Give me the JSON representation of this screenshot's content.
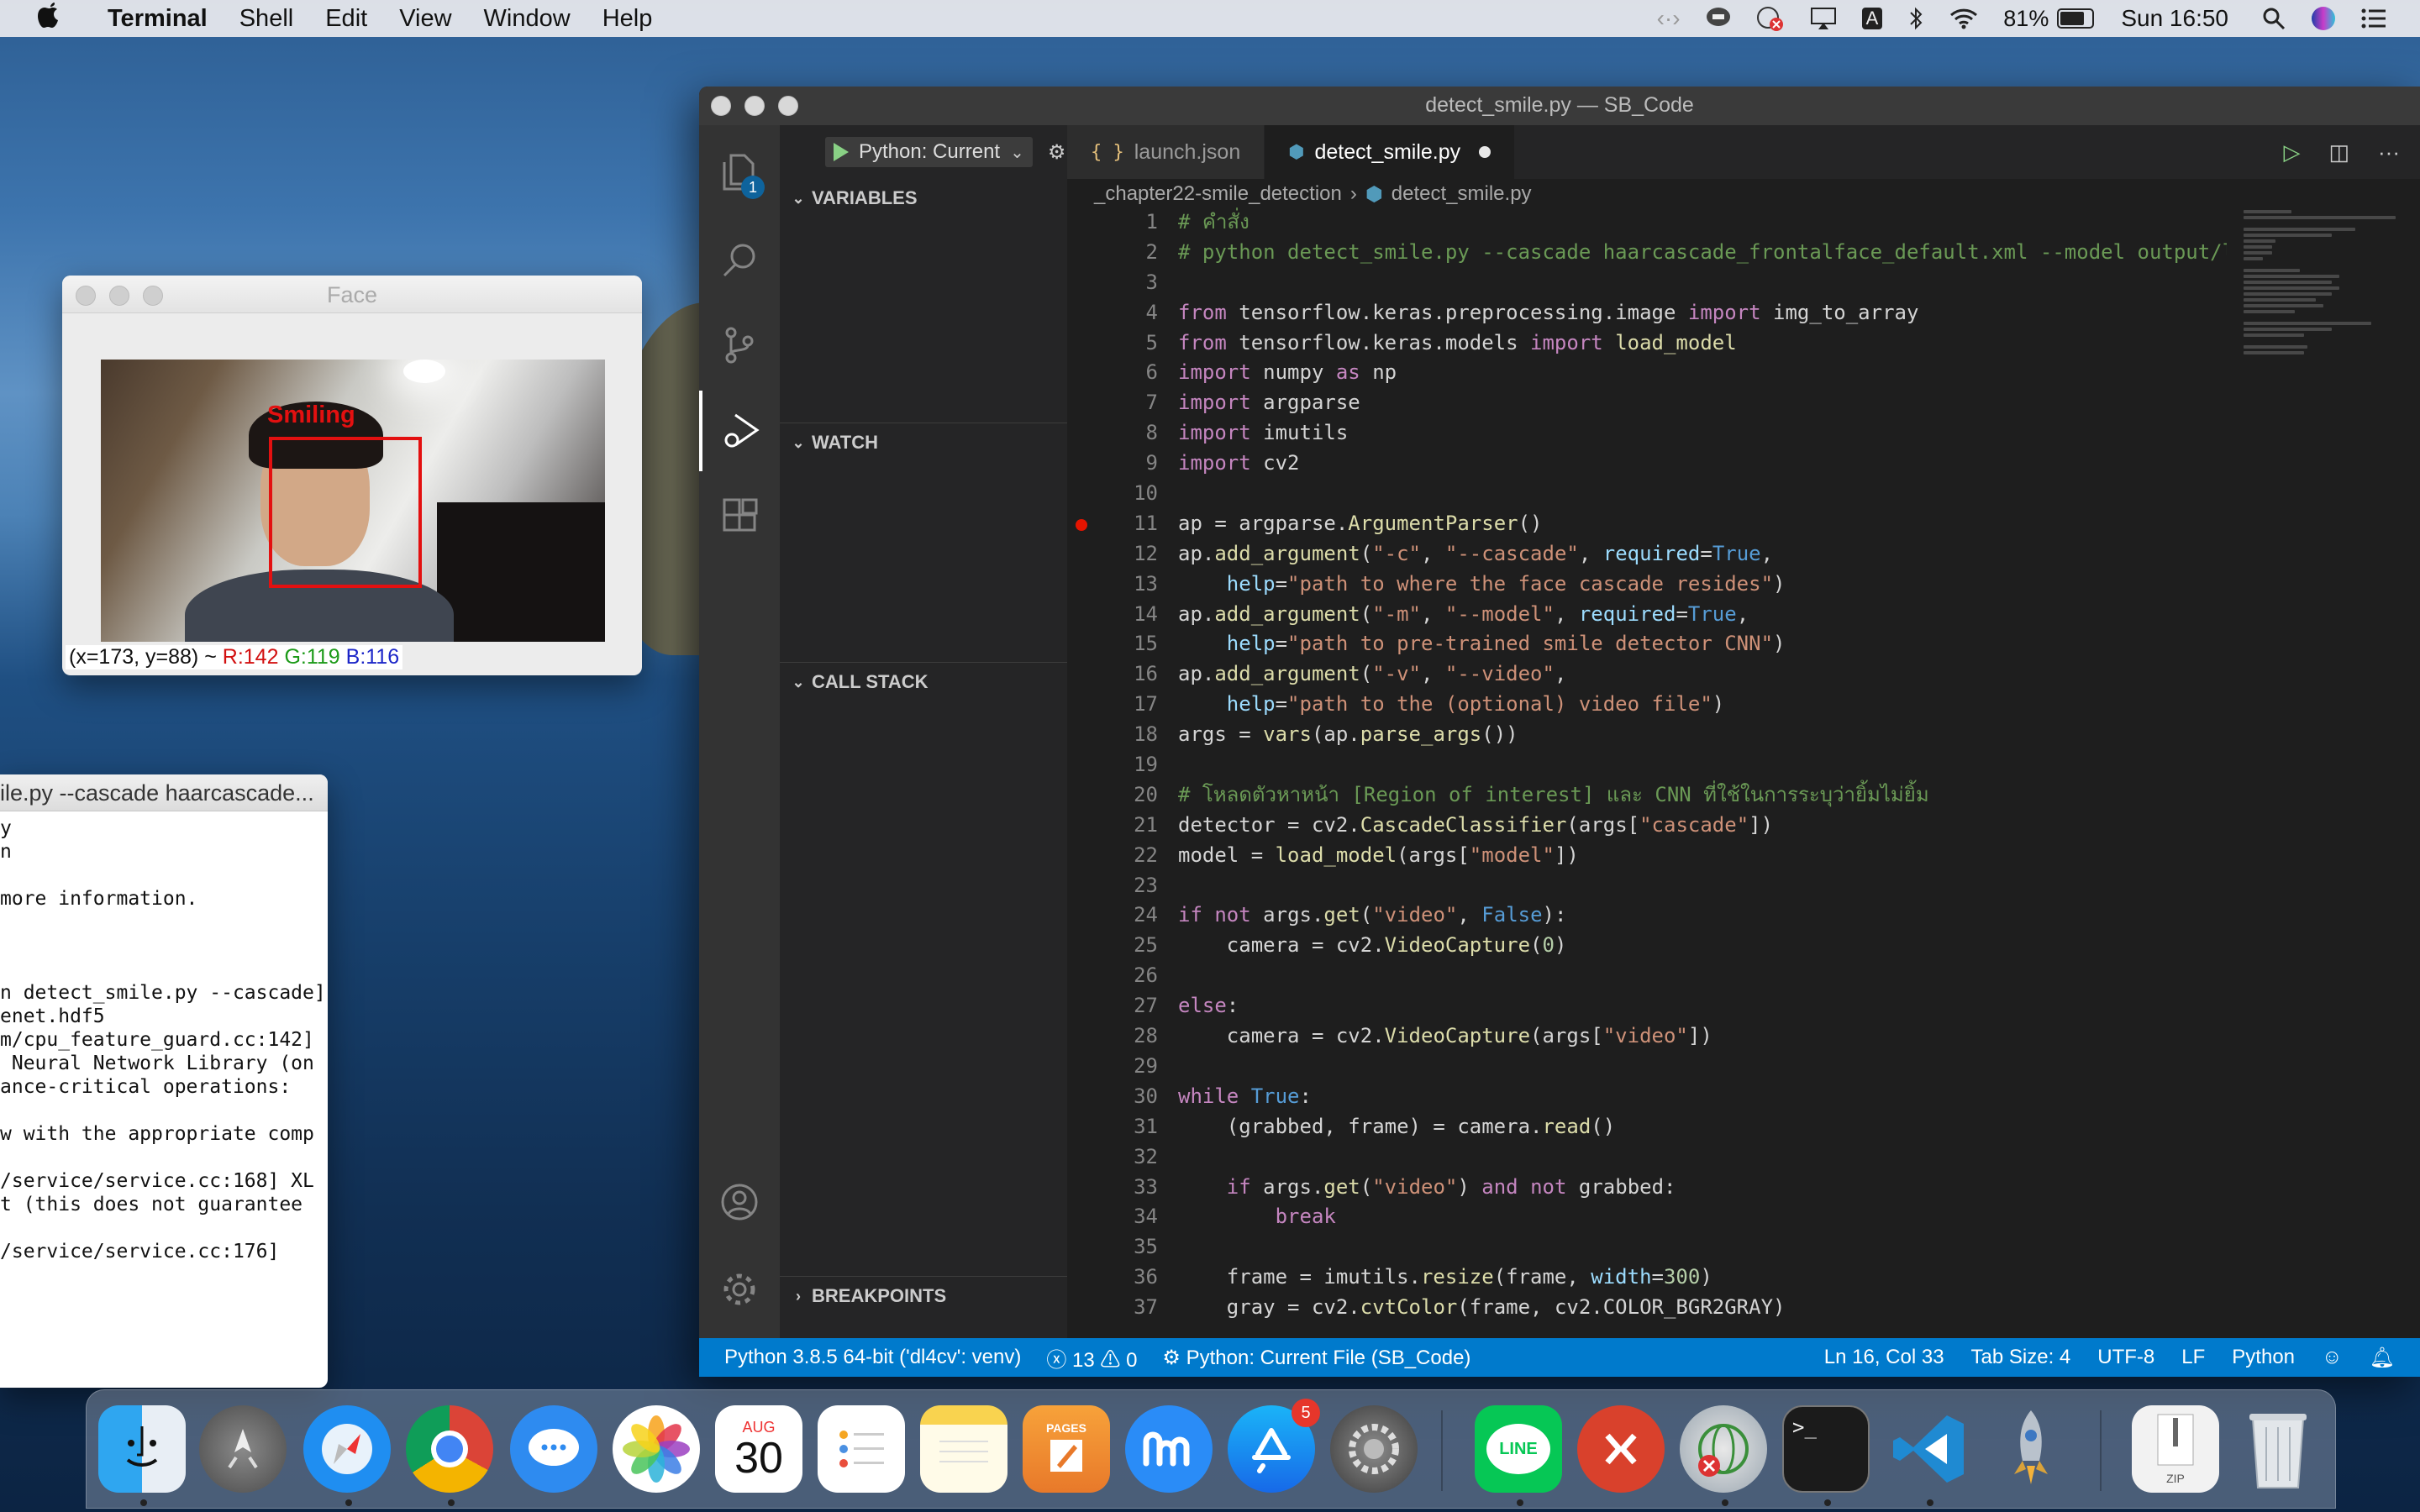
{
  "menubar": {
    "app_name": "Terminal",
    "items": [
      "Shell",
      "Edit",
      "View",
      "Window",
      "Help"
    ],
    "battery": "81%",
    "clock": "Sun 16:50"
  },
  "face_window": {
    "title": "Face",
    "label": "Smiling",
    "pixel_info": {
      "coords": "(x=173, y=88) ~",
      "r": "R:142",
      "g": "G:119",
      "b": "B:116"
    }
  },
  "terminal_window": {
    "title": "ile.py --cascade haarcascade...",
    "lines": [
      "y",
      "n                           ]",
      "",
      "more information.",
      "                            ]",
      "                            ]",
      "                            ]",
      "n detect_smile.py --cascade]",
      "enet.hdf5",
      "m/cpu_feature_guard.cc:142]",
      " Neural Network Library (on",
      "ance-critical operations:",
      "",
      "w with the appropriate comp",
      "",
      "/service/service.cc:168] XL",
      "t (this does not guarantee",
      "",
      "/service/service.cc:176]"
    ]
  },
  "vscode": {
    "title": "detect_smile.py — SB_Code",
    "explorer_badge": "1",
    "debug_config": "Python: Current",
    "sections": {
      "variables": "VARIABLES",
      "watch": "WATCH",
      "call_stack": "CALL STACK",
      "breakpoints": "BREAKPOINTS"
    },
    "tabs": [
      {
        "icon": "{ }",
        "label": "launch.json"
      },
      {
        "label": "detect_smile.py"
      }
    ],
    "breadcrumb": {
      "folder": "_chapter22-smile_detection",
      "file": "detect_smile.py"
    },
    "code_lines": [
      "# คำสั่ง",
      "# python detect_smile.py --cascade haarcascade_frontalface_default.xml --model output/l",
      "",
      "from tensorflow.keras.preprocessing.image import img_to_array",
      "from tensorflow.keras.models import load_model",
      "import numpy as np",
      "import argparse",
      "import imutils",
      "import cv2",
      "",
      "ap = argparse.ArgumentParser()",
      "ap.add_argument(\"-c\", \"--cascade\", required=True,",
      "    help=\"path to where the face cascade resides\")",
      "ap.add_argument(\"-m\", \"--model\", required=True,",
      "    help=\"path to pre-trained smile detector CNN\")",
      "ap.add_argument(\"-v\", \"--video\",",
      "    help=\"path to the (optional) video file\")",
      "args = vars(ap.parse_args())",
      "",
      "# โหลดตัวหาหน้า [Region of interest] และ CNN ที่ใช้ในการระบุว่ายิ้มไม่ยิ้ม",
      "detector = cv2.CascadeClassifier(args[\"cascade\"])",
      "model = load_model(args[\"model\"])",
      "",
      "if not args.get(\"video\", False):",
      "    camera = cv2.VideoCapture(0)",
      "",
      "else:",
      "    camera = cv2.VideoCapture(args[\"video\"])",
      "",
      "while True:",
      "    (grabbed, frame) = camera.read()",
      "",
      "    if args.get(\"video\") and not grabbed:",
      "        break",
      "",
      "    frame = imutils.resize(frame, width=300)",
      "    gray = cv2.cvtColor(frame, cv2.COLOR_BGR2GRAY)"
    ],
    "statusbar": {
      "interpreter": "Python 3.8.5 64-bit ('dl4cv': venv)",
      "errors": "13",
      "warnings": "0",
      "debug": "Python: Current File (SB_Code)",
      "position": "Ln 16, Col 33",
      "tab_size": "Tab Size: 4",
      "encoding": "UTF-8",
      "eol": "LF",
      "language": "Python"
    }
  },
  "dock": {
    "calendar_month": "AUG",
    "calendar_day": "30",
    "appstore_badge": "5",
    "line_label": "LINE",
    "pages_label": "PAGES",
    "zip_label": "ZIP",
    "terminal_prompt": ">_"
  },
  "colors": {
    "vscode_status": "#007acc",
    "detection_red": "#e31010"
  }
}
